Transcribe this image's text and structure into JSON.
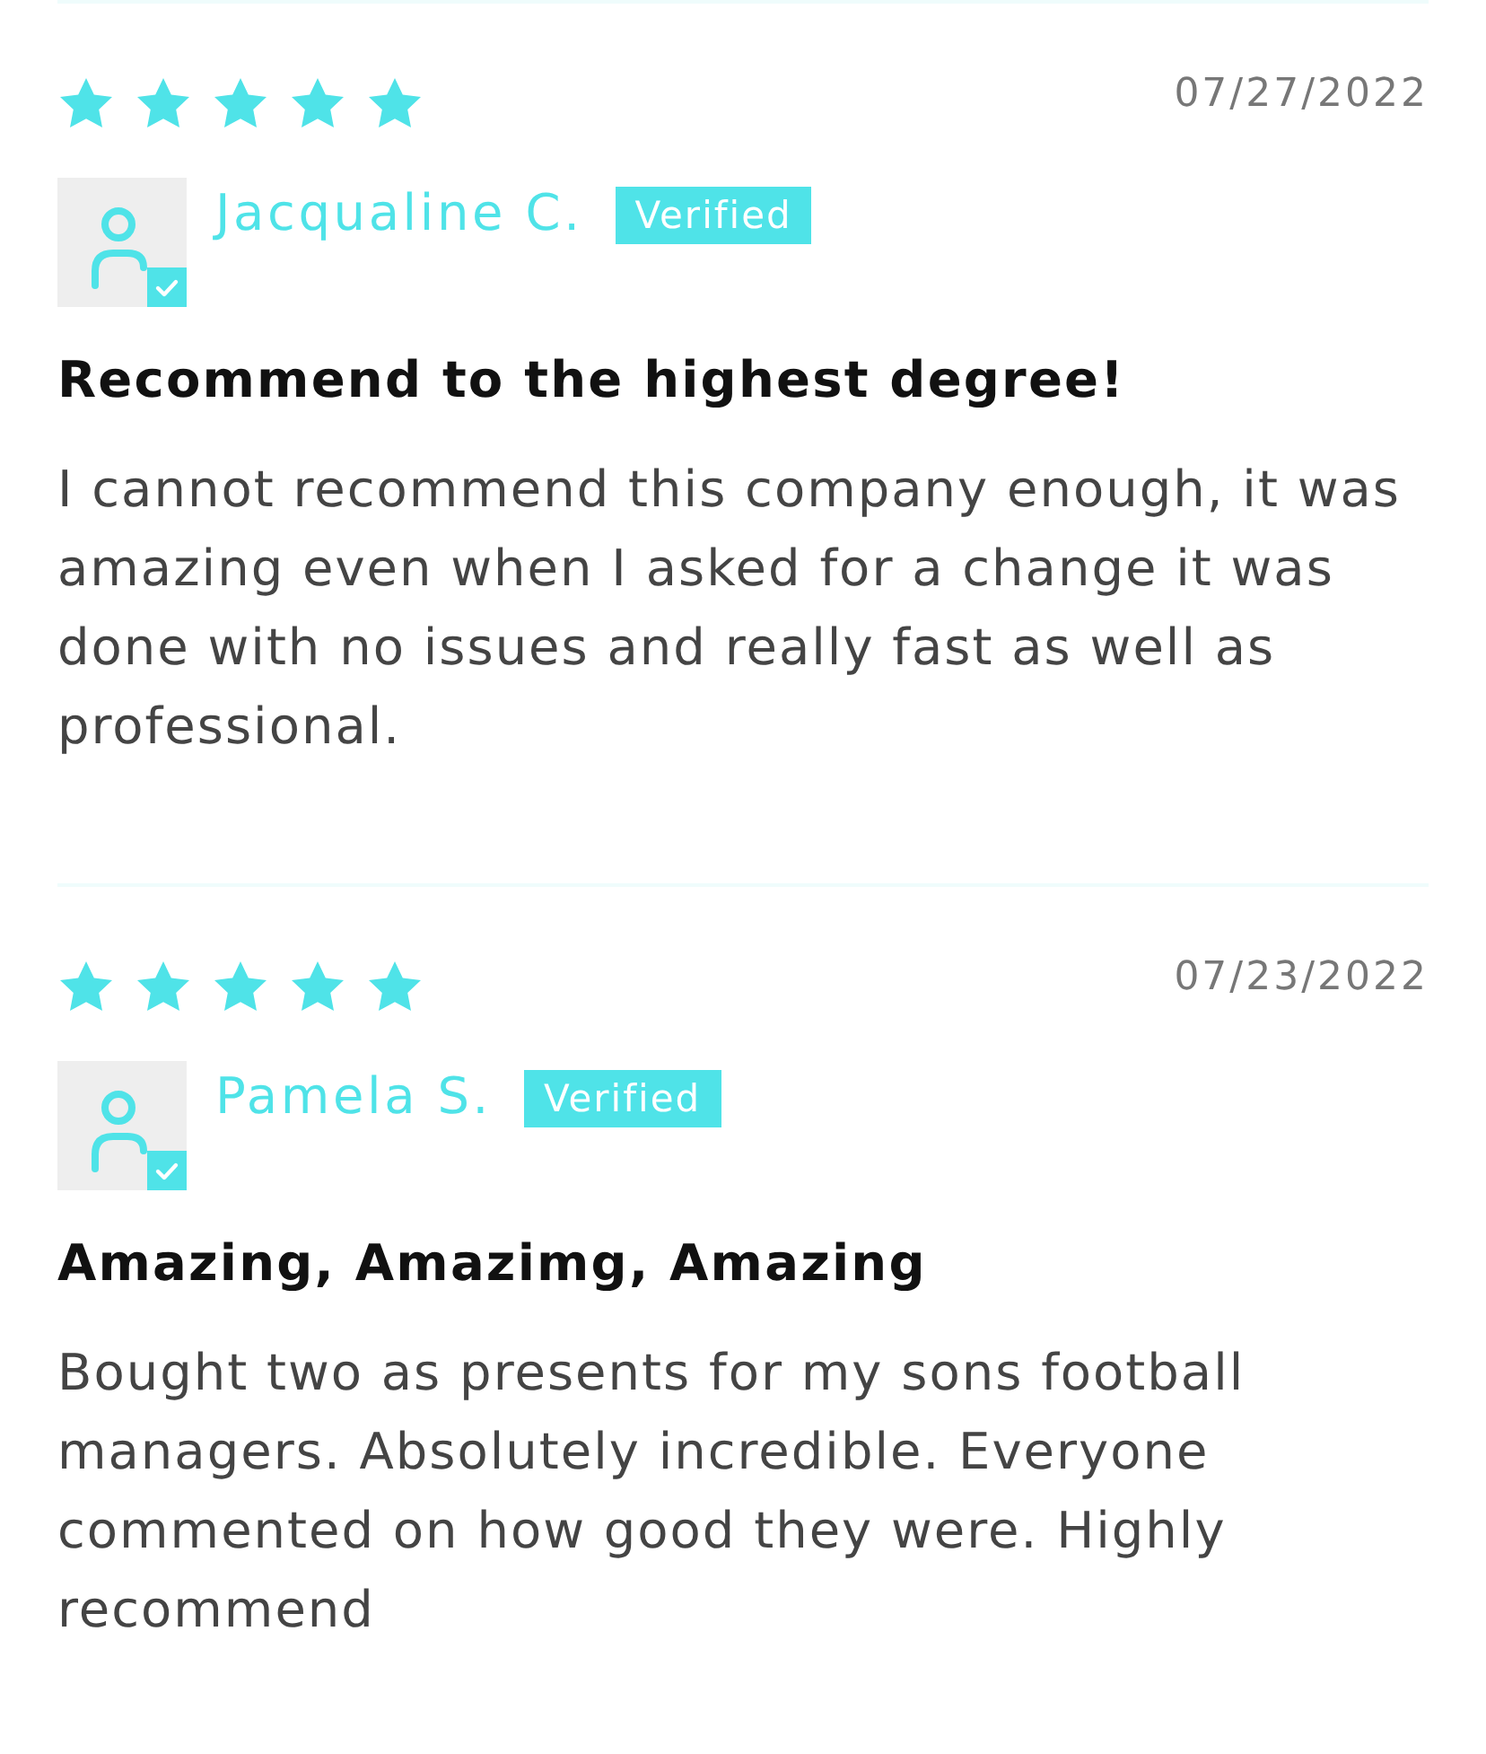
{
  "reviews": [
    {
      "stars": 5,
      "date": "07/27/2022",
      "author": "Jacqualine C.",
      "badge": "Verified",
      "title": "Recommend to the highest degree!",
      "body": "I cannot recommend this company enough, it was amazing even when I asked for a change it was done with no issues and really fast as well as professional."
    },
    {
      "stars": 5,
      "date": "07/23/2022",
      "author": "Pamela S.",
      "badge": "Verified",
      "title": "Amazing, Amazimg, Amazing",
      "body": "Bought two as presents for my sons football managers. Absolutely incredible. Everyone commented on how good they were. Highly recommend"
    }
  ]
}
